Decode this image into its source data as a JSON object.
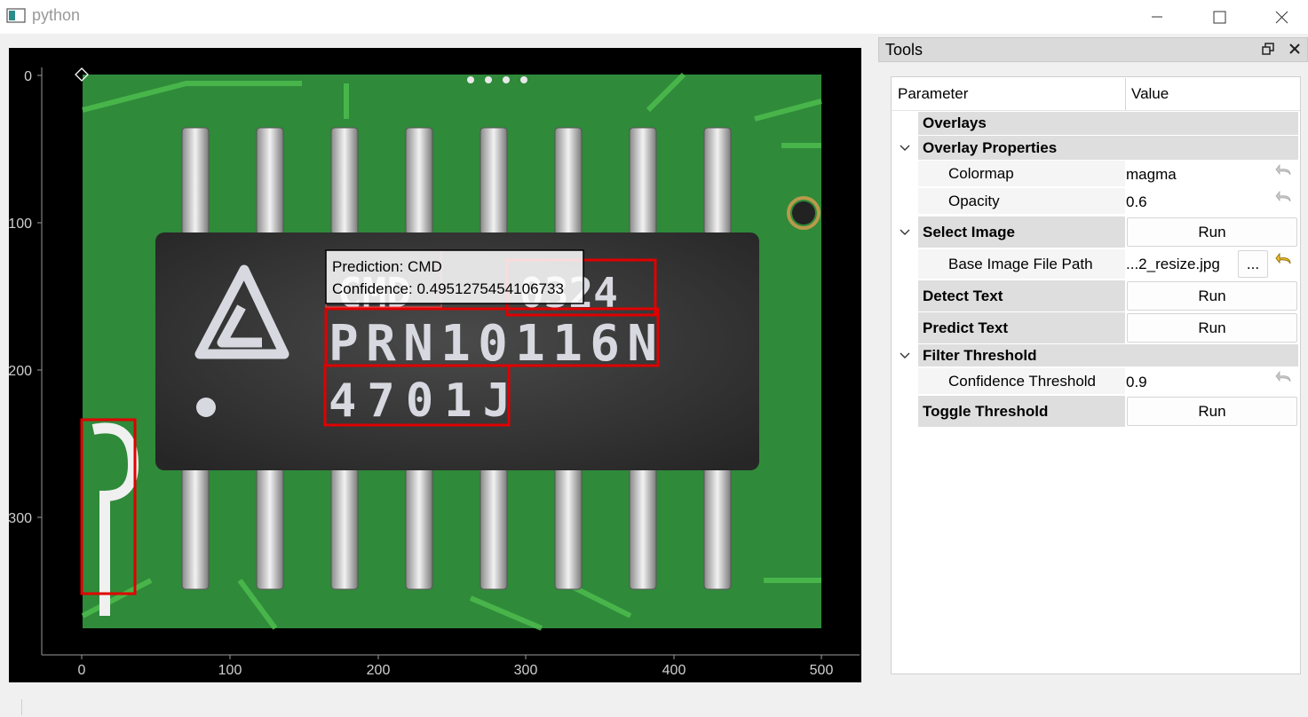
{
  "window": {
    "title": "python",
    "controls": [
      "minimize-icon",
      "maximize-icon",
      "close-icon"
    ]
  },
  "plot": {
    "y_ticks": [
      "0",
      "100",
      "200",
      "300"
    ],
    "x_ticks": [
      "0",
      "100",
      "200",
      "300",
      "400",
      "500"
    ],
    "box_color": "#e00000",
    "detections": [
      {
        "label": "0324"
      },
      {
        "label": "PRN10116N"
      },
      {
        "label": "4701J"
      },
      {
        "label": "p"
      }
    ],
    "tooltip": {
      "prediction": "Prediction: CMD",
      "confidence": "Confidence: 0.4951275454106733"
    }
  },
  "dock": {
    "title": "Tools",
    "header": {
      "parameter": "Parameter",
      "value": "Value"
    },
    "overlays": "Overlays",
    "overlay_properties": "Overlay Properties",
    "colormap_label": "Colormap",
    "colormap_value": "magma",
    "opacity_label": "Opacity",
    "opacity_value": "0.6",
    "select_image": "Select Image",
    "select_image_run": "Run",
    "base_path_label": "Base Image File Path",
    "base_path_value": "...2_resize.jpg",
    "browse_label": "...",
    "detect_text": "Detect Text",
    "detect_text_run": "Run",
    "predict_text": "Predict Text",
    "predict_text_run": "Run",
    "filter_threshold": "Filter Threshold",
    "confidence_label": "Confidence Threshold",
    "confidence_value": "0.9",
    "toggle_threshold": "Toggle Threshold",
    "toggle_threshold_run": "Run"
  }
}
